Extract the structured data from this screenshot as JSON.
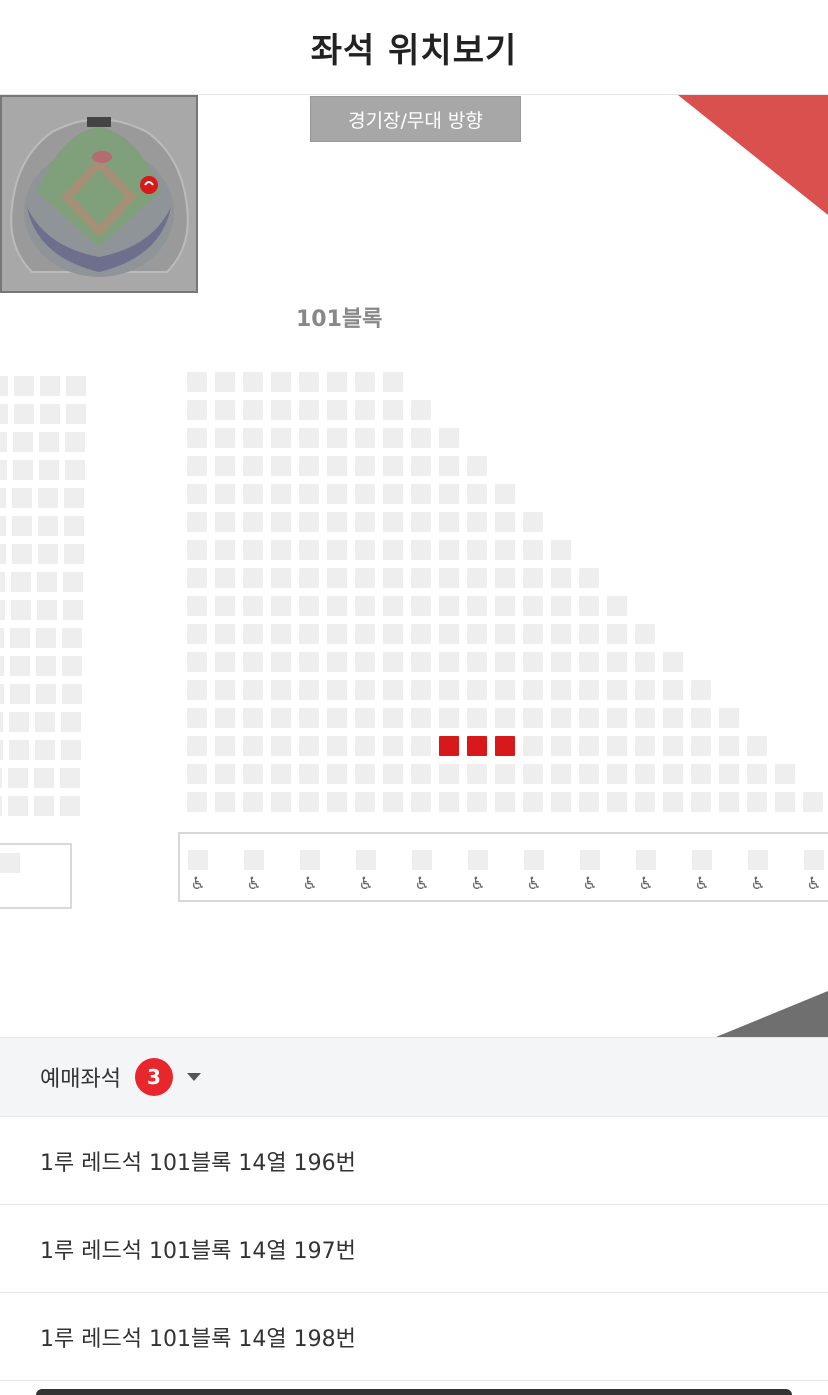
{
  "header": {
    "title": "좌석 위치보기"
  },
  "map": {
    "direction_button": "경기장/무대 방향",
    "block_label": "101블록",
    "selected_seats": [
      {
        "row": 14,
        "col": 9
      },
      {
        "row": 14,
        "col": 10
      },
      {
        "row": 14,
        "col": 11
      }
    ],
    "wheelchair_icon": "wheelchair-icon"
  },
  "reservation": {
    "label": "예매좌석",
    "count": "3",
    "items": [
      {
        "text": "1루 레드석 101블록 14열 196번"
      },
      {
        "text": "1루 레드석 101블록 14열 197번"
      },
      {
        "text": "1루 레드석 101블록 14열 198번"
      }
    ]
  },
  "colors": {
    "selected_seat": "#d7191b",
    "empty_seat": "#eeeeee",
    "badge": "#e8272d",
    "corner_red": "#d9504f"
  }
}
